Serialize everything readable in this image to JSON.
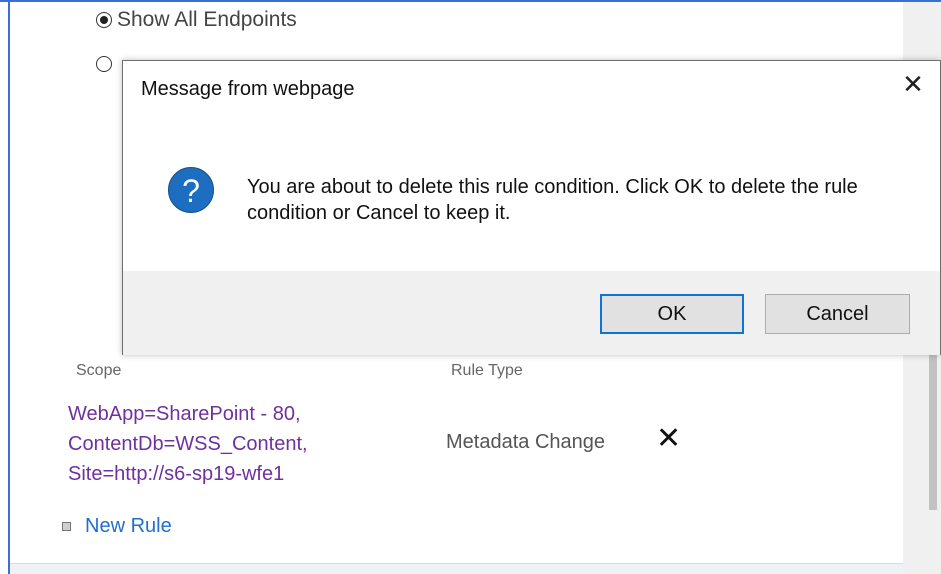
{
  "page": {
    "radio_options": [
      {
        "label": "Show All Endpoints",
        "checked": true
      },
      {
        "label": "",
        "checked": false
      }
    ],
    "columns": {
      "scope": "Scope",
      "rule_type": "Rule Type"
    },
    "rule": {
      "scope_lines": [
        "WebApp=SharePoint - 80,",
        "ContentDb=WSS_Content,",
        "Site=http://s6-sp19-wfe1"
      ],
      "rule_type": "Metadata Change",
      "delete_icon": "close-x-icon"
    },
    "new_rule_label": "New Rule"
  },
  "dialog": {
    "title": "Message from webpage",
    "icon": "question-icon",
    "icon_glyph": "?",
    "message": "You are about to delete this rule condition. Click OK to delete the rule condition or Cancel to keep it.",
    "ok_label": "OK",
    "cancel_label": "Cancel",
    "close_glyph": "✕"
  },
  "colors": {
    "accent": "#0a74d8",
    "link": "#1f6fd0",
    "scope_text": "#7030a0",
    "question_icon": "#1d6ec0"
  }
}
